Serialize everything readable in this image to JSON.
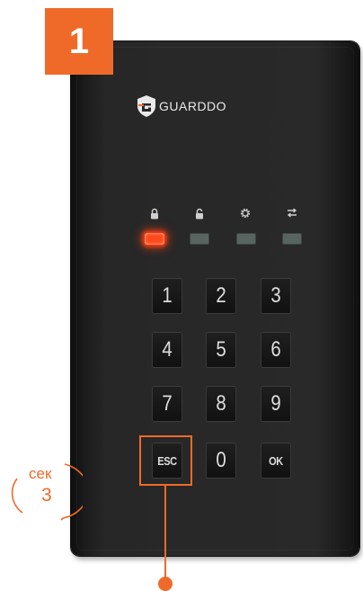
{
  "step": {
    "number": "1"
  },
  "brand": {
    "name": "GUARDDO"
  },
  "status_indicators": [
    {
      "icon": "lock-icon",
      "state": "on"
    },
    {
      "icon": "unlock-icon",
      "state": "off"
    },
    {
      "icon": "gear-icon",
      "state": "off"
    },
    {
      "icon": "transfer-arrows-icon",
      "state": "off"
    }
  ],
  "keypad": {
    "keys": [
      "1",
      "2",
      "3",
      "4",
      "5",
      "6",
      "7",
      "8",
      "9",
      "ESC",
      "0",
      "OK"
    ],
    "highlighted_key": "ESC"
  },
  "timer": {
    "unit": "сек",
    "value": "3"
  },
  "colors": {
    "accent": "#ef6a29",
    "led_on": "#ff4a1c",
    "led_off": "#586460",
    "device_body": "#272727"
  }
}
